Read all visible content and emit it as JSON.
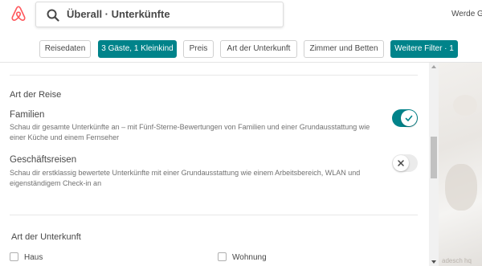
{
  "header": {
    "search_text": "Überall · Unterkünfte",
    "right_text": "Werde G"
  },
  "filters": [
    {
      "label": "Reisedaten",
      "active": false
    },
    {
      "label": "3 Gäste, 1 Kleinkind",
      "active": true
    },
    {
      "label": "Preis",
      "active": false
    },
    {
      "label": "Art der Unterkunft",
      "active": false
    },
    {
      "label": "Zimmer und Betten",
      "active": false
    },
    {
      "label": "Weitere Filter · 1",
      "active": true
    }
  ],
  "panel": {
    "trip_type": {
      "title": "Art der Reise",
      "options": [
        {
          "title": "Familien",
          "description": "Schau dir gesamte Unterkünfte an – mit Fünf-Sterne-Bewertungen von Familien und einer Grundausstattung wie einer Küche und einem Fernseher",
          "enabled": true
        },
        {
          "title": "Geschäftsreisen",
          "description": "Schau dir erstklassig bewertete Unterkünfte mit einer Grundausstattung wie einem Arbeitsbereich, WLAN und eigenständigem Check-in an",
          "enabled": false
        }
      ]
    },
    "property_type": {
      "title": "Art der Unterkunft",
      "options": [
        {
          "label": "Haus",
          "checked": false
        },
        {
          "label": "Wohnung",
          "checked": false
        }
      ]
    }
  },
  "map": {
    "text": "adesch hq"
  },
  "colors": {
    "accent": "#00838a",
    "logo": "#ff5a5f",
    "text": "#484848",
    "muted": "#717171"
  }
}
